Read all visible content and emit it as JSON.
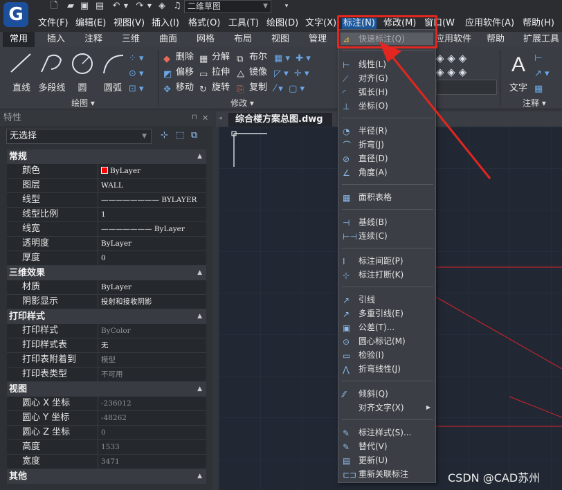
{
  "app": {
    "logo_letter": "G",
    "workspace": "二维草图"
  },
  "menubar": [
    {
      "label": "文件(F)"
    },
    {
      "label": "编辑(E)"
    },
    {
      "label": "视图(V)"
    },
    {
      "label": "插入(I)"
    },
    {
      "label": "格式(O)"
    },
    {
      "label": "工具(T)"
    },
    {
      "label": "绘图(D)"
    },
    {
      "label": "文字(X)"
    },
    {
      "label": "标注(N)"
    },
    {
      "label": "修改(M)"
    },
    {
      "label": "窗口(W)"
    },
    {
      "label": "应用软件(A)"
    },
    {
      "label": "帮助(H)"
    }
  ],
  "ribbon_tabs": [
    {
      "label": "常用"
    },
    {
      "label": "插入"
    },
    {
      "label": "注释"
    },
    {
      "label": "三维"
    },
    {
      "label": "曲面"
    },
    {
      "label": "网格"
    },
    {
      "label": "布局"
    },
    {
      "label": "视图"
    },
    {
      "label": "管理"
    },
    {
      "label": "应用软件"
    },
    {
      "label": "帮助"
    },
    {
      "label": "扩展工具"
    }
  ],
  "ribbon": {
    "draw": {
      "line": "直线",
      "pline": "多段线",
      "circle": "圆",
      "arc": "圆弧",
      "group": "绘图"
    },
    "modify": {
      "delete": "删除",
      "explode": "分解",
      "boolean": "布尔",
      "offset": "偏移",
      "stretch": "拉伸",
      "mirror": "镜像",
      "move": "移动",
      "rotate": "旋转",
      "copy": "复制",
      "group": "修改"
    },
    "annot": {
      "text": "文字",
      "group": "注释"
    }
  },
  "panel": {
    "title": "特性",
    "selection": "无选择",
    "sections": [
      {
        "title": "常规",
        "rows": [
          {
            "k": "颜色",
            "v": "ByLayer"
          },
          {
            "k": "图层",
            "v": "WALL"
          },
          {
            "k": "线型",
            "v": "———————— BYLAYER"
          },
          {
            "k": "线型比例",
            "v": "1"
          },
          {
            "k": "线宽",
            "v": "——————— ByLayer"
          },
          {
            "k": "透明度",
            "v": "ByLayer"
          },
          {
            "k": "厚度",
            "v": "0"
          }
        ]
      },
      {
        "title": "三维效果",
        "rows": [
          {
            "k": "材质",
            "v": "ByLayer"
          },
          {
            "k": "阴影显示",
            "v": "投射和接收阴影"
          }
        ]
      },
      {
        "title": "打印样式",
        "rows": [
          {
            "k": "打印样式",
            "v": "ByColor"
          },
          {
            "k": "打印样式表",
            "v": "无"
          },
          {
            "k": "打印表附着到",
            "v": "模型"
          },
          {
            "k": "打印表类型",
            "v": "不可用"
          }
        ]
      },
      {
        "title": "视图",
        "rows": [
          {
            "k": "圆心 X 坐标",
            "v": "-236012"
          },
          {
            "k": "圆心 Y 坐标",
            "v": "-48262"
          },
          {
            "k": "圆心 Z 坐标",
            "v": "0"
          },
          {
            "k": "高度",
            "v": "1533"
          },
          {
            "k": "宽度",
            "v": "3471"
          }
        ]
      },
      {
        "title": "其他",
        "rows": []
      }
    ]
  },
  "document_tab": "综合楼方案总图.dwg",
  "dim_menu": {
    "items": [
      "快速标注(Q)",
      "线性(L)",
      "对齐(G)",
      "弧长(H)",
      "坐标(O)",
      "半径(R)",
      "折弯(J)",
      "直径(D)",
      "角度(A)",
      "面积表格",
      "基线(B)",
      "连续(C)",
      "标注间距(P)",
      "标注打断(K)",
      "引线",
      "多重引线(E)",
      "公差(T)...",
      "圆心标记(M)",
      "检验(I)",
      "折弯线性(J)",
      "倾斜(Q)",
      "对齐文字(X)",
      "标注样式(S)...",
      "替代(V)",
      "更新(U)",
      "重新关联标注"
    ]
  },
  "watermark": "CSDN @CAD苏州",
  "colors": {
    "accent": "#1d5a9e",
    "highlight_red": "#e3261f",
    "bylayer_red": "#ff0000"
  }
}
